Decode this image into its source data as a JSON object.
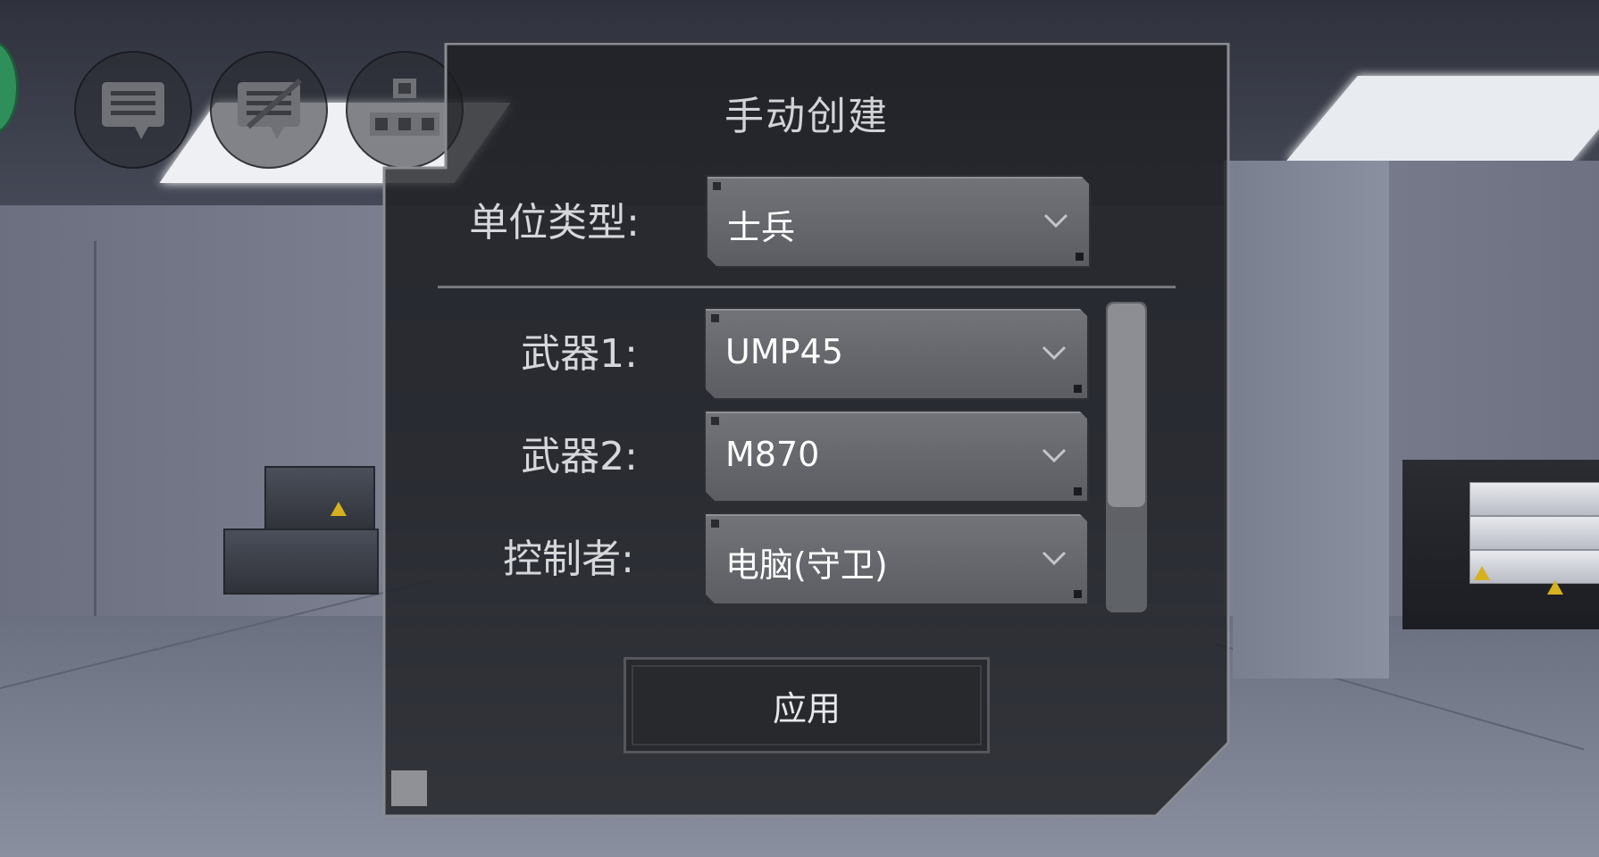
{
  "toolbar": {
    "buttons": [
      {
        "icon": "chat-bubble-icon"
      },
      {
        "icon": "edit-chat-icon"
      },
      {
        "icon": "hierarchy-icon"
      }
    ]
  },
  "dialog": {
    "title": "手动创建",
    "unit_type": {
      "label": "单位类型:",
      "value": "士兵"
    },
    "fields": [
      {
        "label": "武器1:",
        "value": "UMP45"
      },
      {
        "label": "武器2:",
        "value": "M870"
      },
      {
        "label": "控制者:",
        "value": "电脑(守卫)"
      }
    ],
    "apply_label": "应用"
  },
  "colors": {
    "dialog_bg": "#1e1f23",
    "dropdown_bg": "#6e7076",
    "text": "#ffffff",
    "label": "#d6d7da"
  }
}
